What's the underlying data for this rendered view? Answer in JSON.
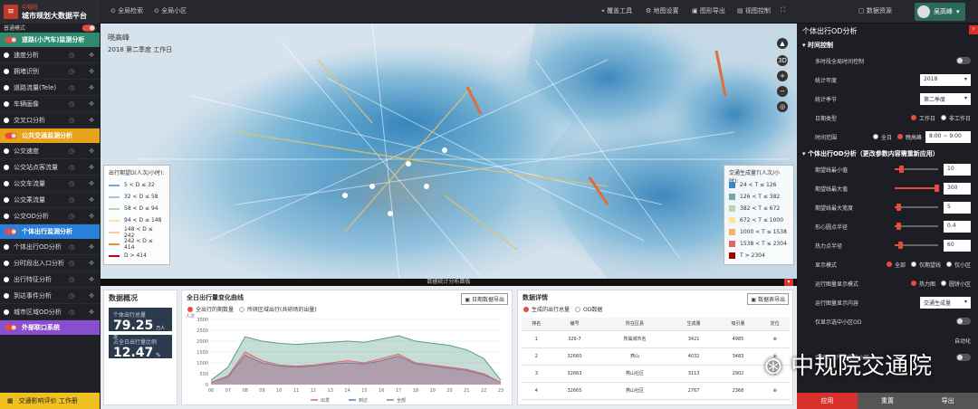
{
  "brand": {
    "line1": "中规院",
    "line2": "城市规划大数据平台"
  },
  "topnav": [
    {
      "label": "全局检索"
    },
    {
      "label": "全局小区"
    }
  ],
  "toolbar": [
    {
      "label": "覆盖工具"
    },
    {
      "label": "地图设置"
    },
    {
      "label": "图形导出"
    },
    {
      "label": "视图控制"
    }
  ],
  "top_right": {
    "label": "数据资源",
    "user": "吴高峰"
  },
  "sidebar": {
    "mode_label": "普通模式",
    "groups": [
      {
        "label": "道路(小汽车)监测分析",
        "color": "#2d8a6e",
        "items": [
          "速度分析",
          "拥堵识别",
          "道路流量(Tele)",
          "车辆画像",
          "交叉口分析"
        ]
      },
      {
        "label": "公共交通监测分析",
        "color": "#e5a21a",
        "items": [
          "公交速度",
          "公交站点客流量",
          "公交车流量",
          "公交乘流量",
          "公交OD分析"
        ]
      },
      {
        "label": "个体出行监测分析",
        "color": "#2a7fd6",
        "items": [
          "个体出行OD分析",
          "分时段出入口分析",
          "出行特征分析",
          "到达事件分析",
          "城市区域OD分析"
        ]
      },
      {
        "label": "外部联口系统",
        "color": "#8a4fd0",
        "items": []
      }
    ],
    "footer": "交通影响评价 工作册"
  },
  "map": {
    "title": "晓高峰",
    "subtitle": "2018 第二季度 工作日"
  },
  "legend_left": {
    "title": "出行期望D(人次/小时):",
    "rows": [
      {
        "label": "5 < D ≤ 32",
        "color": "#6fa8dc"
      },
      {
        "label": "32 < D ≤ 58",
        "color": "#9fc5e8"
      },
      {
        "label": "58 < D ≤ 94",
        "color": "#b6d7a8"
      },
      {
        "label": "94 < D ≤ 148",
        "color": "#ffe599"
      },
      {
        "label": "148 < D ≤ 242",
        "color": "#f9cb9c"
      },
      {
        "label": "242 < D ≤ 414",
        "color": "#e69138"
      },
      {
        "label": "D > 414",
        "color": "#cc0000"
      }
    ]
  },
  "legend_right": {
    "title": "交通生成量T(人次/小时):",
    "rows": [
      {
        "label": "24 < T ≤ 126",
        "color": "#3d85c6"
      },
      {
        "label": "126 < T ≤ 382",
        "color": "#76a5af"
      },
      {
        "label": "382 < T ≤ 672",
        "color": "#b6d7a8"
      },
      {
        "label": "672 < T ≤ 1000",
        "color": "#ffe599"
      },
      {
        "label": "1000 < T ≤ 1538",
        "color": "#f6b26b"
      },
      {
        "label": "1538 < T ≤ 2304",
        "color": "#e06666"
      },
      {
        "label": "T > 2304",
        "color": "#990000"
      }
    ]
  },
  "strip_label": "数据统计分析面板",
  "overview": {
    "title": "数据概况",
    "stat1": {
      "label": "个体出行总量",
      "value": "79.25",
      "unit": "万人次"
    },
    "stat2": {
      "label": "占全日出行量比例",
      "value": "12.47",
      "unit": "%"
    }
  },
  "chart": {
    "title": "全日出行量变化曲线",
    "export": "日期数据导出",
    "options": [
      "全出行的期数量",
      "所研区域出行(共研场的出量)"
    ],
    "ylabel": "人次"
  },
  "chart_data": {
    "type": "area",
    "x": [
      "06",
      "07",
      "08",
      "09",
      "10",
      "11",
      "12",
      "13",
      "14",
      "15",
      "16",
      "17",
      "18",
      "19",
      "20",
      "21",
      "22",
      "23"
    ],
    "ylim": [
      0,
      3000
    ],
    "yticks": [
      "3000",
      "2500",
      "2000",
      "1500",
      "1000",
      "500",
      "0"
    ],
    "series": [
      {
        "name": "出发",
        "color": "#e06666",
        "values": [
          100,
          400,
          1500,
          1100,
          900,
          850,
          900,
          1000,
          1100,
          1000,
          1200,
          1400,
          1000,
          900,
          800,
          700,
          500,
          100
        ]
      },
      {
        "name": "到达",
        "color": "#3d85c6",
        "values": [
          100,
          350,
          1350,
          1000,
          850,
          800,
          850,
          950,
          1000,
          950,
          1100,
          1300,
          950,
          850,
          750,
          650,
          450,
          100
        ]
      },
      {
        "name": "全部",
        "color": "#5a9e8c",
        "values": [
          200,
          800,
          2200,
          2000,
          1900,
          1850,
          1900,
          1950,
          2000,
          1950,
          2100,
          2250,
          2000,
          1900,
          1800,
          1600,
          1200,
          200
        ]
      }
    ]
  },
  "details": {
    "title": "数据详情",
    "export": "数据表导出",
    "options": [
      "生成的出行总量",
      "OD数据"
    ],
    "columns": [
      "排名",
      "编号",
      "所在区县",
      "生成量",
      "吸引量",
      "定位"
    ],
    "rows": [
      [
        "1",
        "326-7",
        "所属城市名",
        "3421",
        "4985",
        "⊕"
      ],
      [
        "2",
        "32660",
        "燕山",
        "4032",
        "3483",
        "⊕"
      ],
      [
        "3",
        "32663",
        "燕山社区",
        "3113",
        "2902",
        "⊕"
      ],
      [
        "4",
        "32665",
        "燕山社区",
        "2767",
        "2368",
        "⊕"
      ]
    ]
  },
  "right_panel": {
    "title": "个体出行OD分析",
    "sec1": "时间控制",
    "multi_label": "多时段全局时间控制",
    "year_label": "统计年度",
    "year_value": "2018",
    "season_label": "统计季节",
    "season_value": "第二季度",
    "daytype_label": "日期类型",
    "daytype_options": [
      "工作日",
      "非工作日"
    ],
    "time_label": "时间范围",
    "time_options": [
      "全日",
      "晚高峰"
    ],
    "time_value": "8:00 ~ 9:00",
    "sec2": "个体出行OD分析（更改参数内容需重新应用）",
    "sliders": [
      {
        "label": "期望线最小值",
        "value": "10",
        "level": 0.15
      },
      {
        "label": "期望线最大值",
        "value": "300",
        "level": 0.95
      },
      {
        "label": "期望线最大宽度",
        "value": "5",
        "level": 0.08
      },
      {
        "label": "形心圆点半径",
        "value": "0.4",
        "level": 0.08
      },
      {
        "label": "热力点半径",
        "value": "60",
        "level": 0.12
      }
    ],
    "display_label": "显示模式",
    "display_options": [
      "全部",
      "仅期望线",
      "仅小区"
    ],
    "cellmode_label": "运行图量显示模式",
    "cellmode_options": [
      "热力图",
      "圆饼小区"
    ],
    "cellcontent_label": "运行图量显示内容",
    "cellcontent_value": "交通生成量",
    "onlyshow_label": "仅显示选中小区OD",
    "autoselect_label": "自动化",
    "merge_label": "合并显示所选定的小区",
    "buttons": [
      {
        "label": "应用",
        "color": "#d9312b"
      },
      {
        "label": "重置",
        "color": "#555"
      },
      {
        "label": "导出",
        "color": "#555"
      }
    ]
  },
  "watermark": "中规院交通院"
}
